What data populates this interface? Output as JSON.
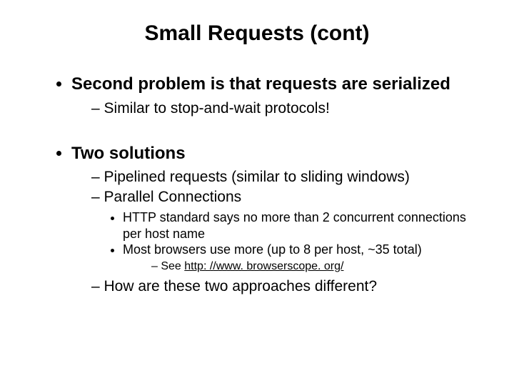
{
  "title": "Small Requests (cont)",
  "bullets": {
    "b1": "Second problem is that requests are serialized",
    "b1_1": "Similar to stop-and-wait protocols!",
    "b2": "Two solutions",
    "b2_1": "Pipelined requests (similar to sliding windows)",
    "b2_2": "Parallel Connections",
    "b2_2_1": "HTTP standard says no more than 2 concurrent connections per host name",
    "b2_2_2": "Most browsers use more (up to 8 per host, ~35 total)",
    "b2_2_2_1_pre": "See ",
    "b2_2_2_1_link": "http: //www. browserscope. org/",
    "b2_3": "How are these two approaches different?"
  }
}
